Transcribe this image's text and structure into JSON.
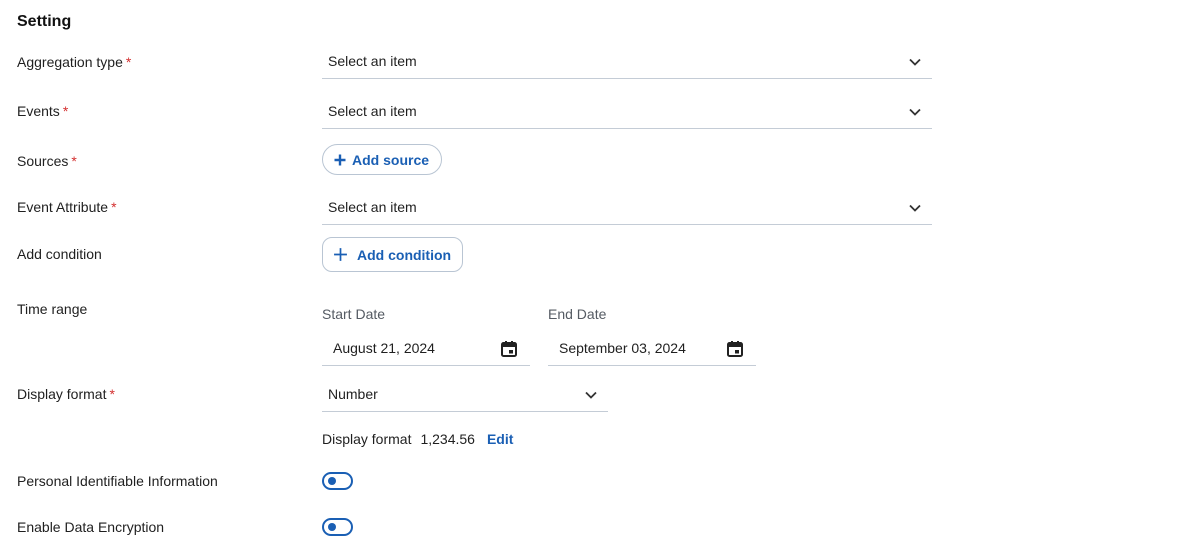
{
  "section_title": "Setting",
  "fields": {
    "aggregation_type": {
      "label": "Aggregation type",
      "value": "Select an item",
      "required_mark": "*"
    },
    "events": {
      "label": "Events",
      "value": "Select an item",
      "required_mark": "*"
    },
    "sources": {
      "label": "Sources",
      "button": "Add source",
      "required_mark": "*"
    },
    "event_attribute": {
      "label": "Event Attribute",
      "value": "Select an item",
      "required_mark": "*"
    },
    "add_condition": {
      "label": "Add condition",
      "button": "Add condition"
    },
    "time_range": {
      "label": "Time range",
      "start_label": "Start Date",
      "start_value": "August 21, 2024",
      "end_label": "End Date",
      "end_value": "September 03, 2024"
    },
    "display_format": {
      "label": "Display format",
      "value": "Number",
      "required_mark": "*",
      "preview_label": "Display format",
      "preview_value": "1,234.56",
      "edit": "Edit"
    },
    "pii": {
      "label": "Personal Identifiable Information"
    },
    "encryption": {
      "label": "Enable Data Encryption"
    }
  },
  "colors": {
    "accent": "#1a5fb4",
    "required": "#d32f2f",
    "border": "#c4ccd6"
  }
}
